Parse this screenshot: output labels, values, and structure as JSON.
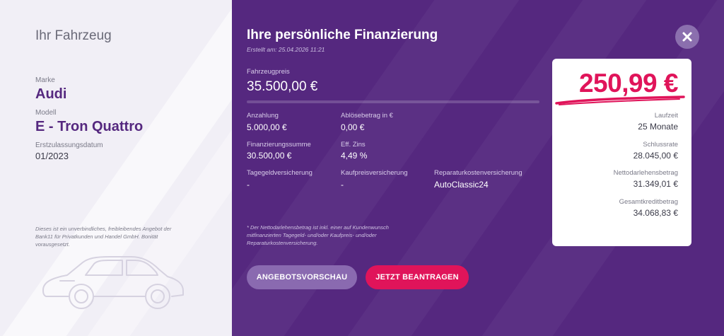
{
  "vehicle": {
    "title": "Ihr Fahrzeug",
    "brand_label": "Marke",
    "brand": "Audi",
    "model_label": "Modell",
    "model": "E - Tron Quattro",
    "first_reg_label": "Erstzulassungsdatum",
    "first_reg": "01/2023",
    "disclaimer": "Dieses ist ein unverbindliches, freibleibendes Angebot der Bank11 für Privatkunden und Handel GmbH. Bonität vorausgesetzt."
  },
  "financing": {
    "title": "Ihre persönliche Finanzierung",
    "created": "Erstellt am: 25.04.2026 11:21",
    "price_label": "Fahrzeugpreis",
    "price": "35.500,00 €",
    "down_payment_label": "Anzahlung",
    "down_payment": "5.000,00 €",
    "payoff_label": "Ablösebetrag in €",
    "payoff": "0,00 €",
    "financing_sum_label": "Finanzierungssumme",
    "financing_sum": "30.500,00 €",
    "eff_interest_label": "Eff. Zins",
    "eff_interest": "4,49 %",
    "daily_insurance_label": "Tagegeldversicherung",
    "daily_insurance": "-",
    "purchase_insurance_label": "Kaufpreisversicherung",
    "purchase_insurance": "-",
    "repair_insurance_label": "Reparaturkostenversicherung",
    "repair_insurance": "AutoClassic24",
    "note": "* Der Nettodarlehensbetrag ist inkl. einer auf Kundenwunsch mitfinanzierten Tagegeld- und/oder Kaufpreis- und/oder Reparaturkostenversicherung."
  },
  "buttons": {
    "preview": "ANGEBOTSVORSCHAU",
    "apply": "JETZT BEANTRAGEN"
  },
  "summary": {
    "rate": "250,99 €",
    "term_label": "Laufzeit",
    "term": "25 Monate",
    "final_rate_label": "Schlussrate",
    "final_rate": "28.045,00 €",
    "net_loan_label": "Nettodarlehensbetrag",
    "net_loan": "31.349,01 €",
    "total_credit_label": "Gesamtkreditbetrag",
    "total_credit": "34.068,83 €"
  },
  "colors": {
    "brand_purple": "#55287f",
    "accent_pink": "#e0145a"
  },
  "icons": {
    "close": "close-icon",
    "car": "car-outline-icon"
  }
}
